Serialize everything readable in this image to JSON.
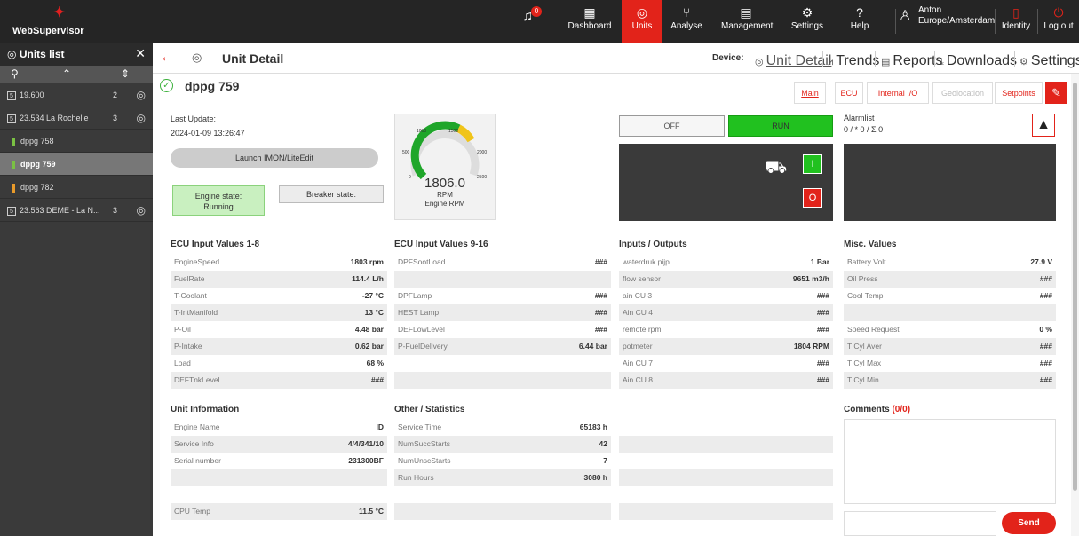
{
  "topbar": {
    "brand": "WebSupervisor",
    "alarm_count": "0",
    "nav": [
      {
        "label": "Dashboard",
        "icon": "dashboard-icon",
        "glyph": "▦"
      },
      {
        "label": "Units",
        "icon": "gauge-icon",
        "glyph": "◎"
      },
      {
        "label": "Analyse",
        "icon": "analyse-icon",
        "glyph": "⑂"
      },
      {
        "label": "Management",
        "icon": "management-icon",
        "glyph": "▤"
      },
      {
        "label": "Settings",
        "icon": "gear-icon",
        "glyph": "⚙"
      },
      {
        "label": "Help",
        "icon": "help-icon",
        "glyph": "?"
      }
    ],
    "user": {
      "name": "Anton",
      "timezone": "Europe/Amsterdam"
    },
    "identity": "Identity",
    "logout": "Log out"
  },
  "sidebar": {
    "title": "Units list",
    "items": [
      {
        "label": "19.600",
        "count": "2",
        "type": "group"
      },
      {
        "label": "23.534 La Rochelle",
        "count": "3",
        "type": "group"
      },
      {
        "label": "dppg 758",
        "type": "unit",
        "status": "#7ac143"
      },
      {
        "label": "dppg 759",
        "type": "unit",
        "status": "#7ac143"
      },
      {
        "label": "dppg 782",
        "type": "unit",
        "status": "#e89a2a"
      },
      {
        "label": "23.563 DEME - La N...",
        "count": "3",
        "type": "group"
      }
    ]
  },
  "header": {
    "title": "Unit Detail",
    "device_label": "Device:",
    "links": [
      "Unit Detail",
      "Trends",
      "Reports",
      "Downloads",
      "Settings"
    ]
  },
  "unit": {
    "name": "dppg 759",
    "tabs": [
      "Main",
      "ECU",
      "Internal I/O",
      "Geolocation",
      "Setpoints"
    ]
  },
  "status": {
    "last_update_label": "Last Update:",
    "last_update": "2024-01-09 13:26:47",
    "launch": "Launch IMON/LiteEdit",
    "engine_state_label": "Engine state:",
    "engine_state": "Running",
    "breaker_state_label": "Breaker state:"
  },
  "gauge": {
    "value": "1806.0",
    "unit": "RPM",
    "label": "Engine RPM",
    "ticks": [
      "0",
      "500",
      "1000",
      "1500",
      "2000",
      "2500"
    ],
    "rpm": 1806,
    "max": 2500
  },
  "control": {
    "off": "OFF",
    "run": "RUN",
    "on_btn": "I",
    "off_btn": "O"
  },
  "alarm": {
    "title": "Alarmlist",
    "counts": "0 / * 0 / Σ 0"
  },
  "ecu18": {
    "title": "ECU Input Values 1-8",
    "rows": [
      [
        "EngineSpeed",
        "1803 rpm"
      ],
      [
        "FuelRate",
        "114.4 L/h"
      ],
      [
        "T-Coolant",
        "-27 °C"
      ],
      [
        "T-IntManifold",
        "13 °C"
      ],
      [
        "P-Oil",
        "4.48 bar"
      ],
      [
        "P-Intake",
        "0.62 bar"
      ],
      [
        "Load",
        "68 %"
      ],
      [
        "DEFTnkLevel",
        "###"
      ]
    ]
  },
  "ecu916": {
    "title": "ECU Input Values 9-16",
    "rows": [
      [
        "DPFSootLoad",
        "###"
      ],
      [
        "",
        ""
      ],
      [
        "DPFLamp",
        "###"
      ],
      [
        "HEST Lamp",
        "###"
      ],
      [
        "DEFLowLevel",
        "###"
      ],
      [
        "P-FuelDelivery",
        "6.44 bar"
      ],
      [
        "",
        ""
      ],
      [
        "",
        ""
      ]
    ]
  },
  "io": {
    "title": "Inputs / Outputs",
    "rows": [
      [
        "waterdruk pijp",
        "1 Bar"
      ],
      [
        "flow sensor",
        "9651 m3/h"
      ],
      [
        "ain CU 3",
        "###"
      ],
      [
        "Ain CU 4",
        "###"
      ],
      [
        "remote rpm",
        "###"
      ],
      [
        "potmeter",
        "1804 RPM"
      ],
      [
        "Ain CU 7",
        "###"
      ],
      [
        "Ain CU 8",
        "###"
      ]
    ]
  },
  "misc": {
    "title": "Misc. Values",
    "rows": [
      [
        "Battery Volt",
        "27.9 V"
      ],
      [
        "Oil Press",
        "###"
      ],
      [
        "Cool Temp",
        "###"
      ],
      [
        "",
        ""
      ],
      [
        "Speed Request",
        "0 %"
      ],
      [
        "T Cyl Aver",
        "###"
      ],
      [
        "T Cyl Max",
        "###"
      ],
      [
        "T Cyl Min",
        "###"
      ]
    ]
  },
  "unitinfo": {
    "title": "Unit Information",
    "rows": [
      [
        "Engine Name",
        "ID"
      ],
      [
        "Service Info",
        "4/4/341/10"
      ],
      [
        "Serial number",
        "231300BF"
      ],
      [
        "",
        ""
      ],
      [
        "",
        ""
      ],
      [
        "CPU Temp",
        "11.5 °C"
      ]
    ]
  },
  "other": {
    "title": "Other / Statistics",
    "rows": [
      [
        "Service Time",
        "65183 h"
      ],
      [
        "NumSuccStarts",
        "42"
      ],
      [
        "NumUnscStarts",
        "7"
      ],
      [
        "Run Hours",
        "3080 h"
      ],
      [
        "",
        ""
      ],
      [
        "",
        ""
      ]
    ]
  },
  "blank": {
    "rows": [
      [
        "",
        ""
      ],
      [
        "",
        ""
      ],
      [
        "",
        ""
      ],
      [
        "",
        ""
      ],
      [
        "",
        ""
      ],
      [
        "",
        ""
      ]
    ]
  },
  "comments": {
    "title": "Comments",
    "count": "(0/0)",
    "send": "Send"
  },
  "colors": {
    "accent": "#e2231a",
    "running": "#c9f0c0",
    "run": "#21c11f"
  }
}
